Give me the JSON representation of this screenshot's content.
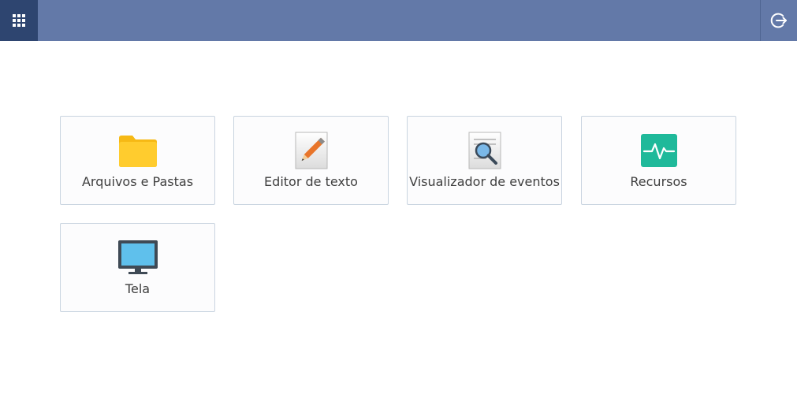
{
  "topbar": {
    "apps_icon": "apps-grid-icon",
    "logout_icon": "logout-icon",
    "color": "#6379a8",
    "apps_button_color": "#2e4570"
  },
  "apps": [
    {
      "label": "Arquivos e Pastas",
      "icon": "folder-icon"
    },
    {
      "label": "Editor de texto",
      "icon": "text-editor-icon"
    },
    {
      "label": "Visualizador de eventos",
      "icon": "event-viewer-icon"
    },
    {
      "label": "Recursos",
      "icon": "resources-icon"
    },
    {
      "label": "Tela",
      "icon": "monitor-icon"
    }
  ]
}
